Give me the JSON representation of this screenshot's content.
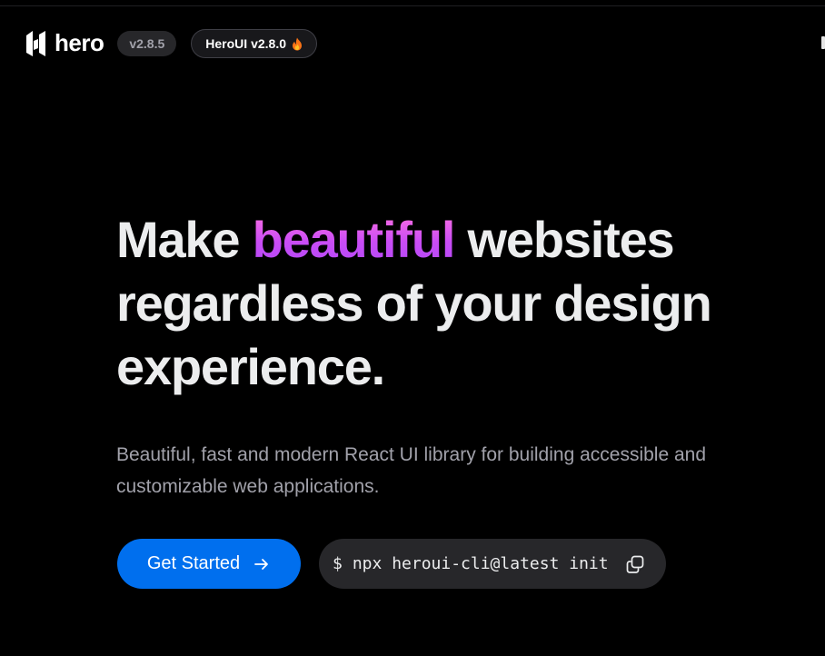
{
  "navbar": {
    "brand_text": "hero",
    "version_chip": "v2.8.5",
    "release_chip": "HeroUI v2.8.0",
    "release_icon": "fire-icon"
  },
  "hero": {
    "title_part1": "Make ",
    "title_accent": "beautiful",
    "title_part2": " websites regardless of your design experience.",
    "subtitle": "Beautiful, fast and modern React UI library for building accessible and customizable web applications."
  },
  "actions": {
    "get_started_label": "Get Started",
    "get_started_icon": "arrow-right-icon",
    "snippet_prompt": "$",
    "snippet_command": "npx heroui-cli@latest init",
    "copy_icon": "copy-icon"
  },
  "colors": {
    "background": "#000000",
    "primary": "#006FEE",
    "accent_gradient_from": "#FF72E1",
    "accent_gradient_to": "#B249F8",
    "text": "#ECEDEE",
    "muted_text": "#a1a1aa",
    "snippet_bg": "#27272a"
  }
}
